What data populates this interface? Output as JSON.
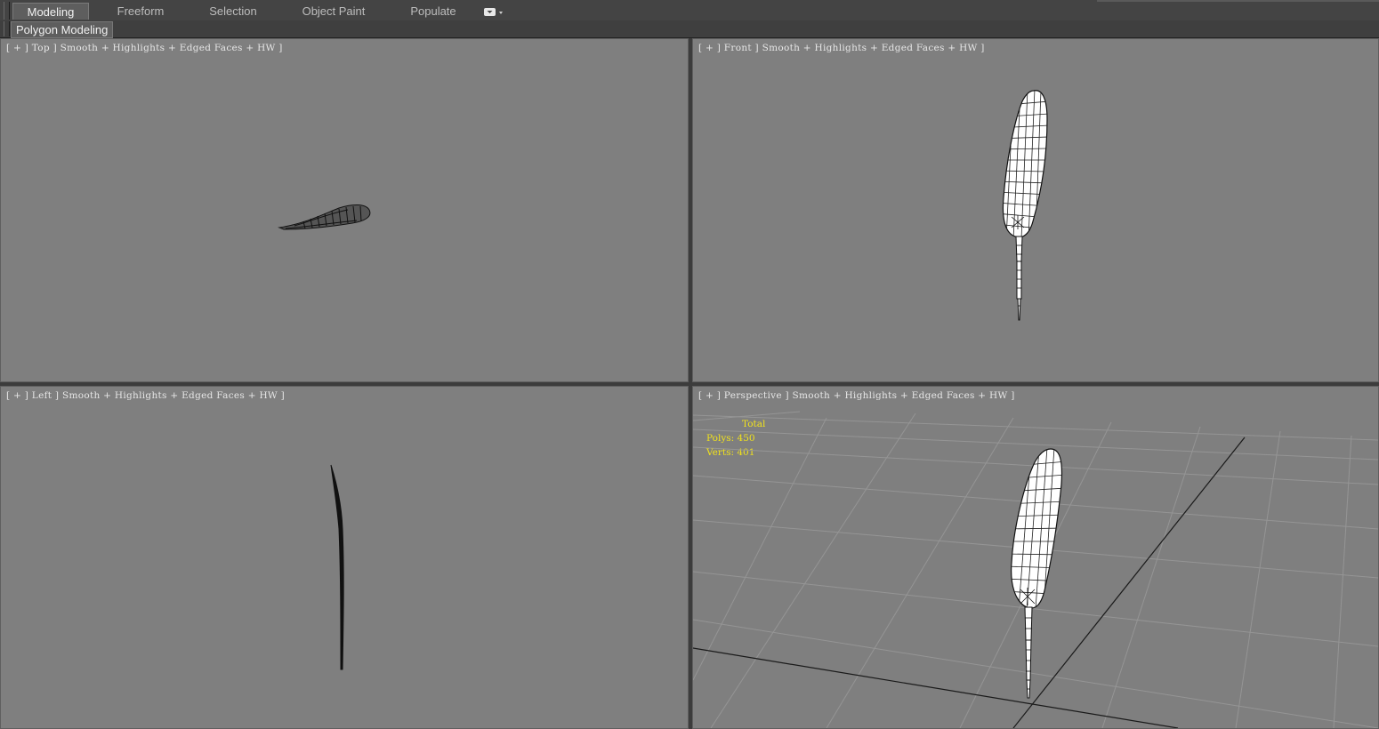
{
  "ribbon": {
    "tabs": [
      {
        "label": "Modeling",
        "active": true
      },
      {
        "label": "Freeform",
        "active": false
      },
      {
        "label": "Selection",
        "active": false
      },
      {
        "label": "Object Paint",
        "active": false
      },
      {
        "label": "Populate",
        "active": false
      }
    ],
    "dropdown_icon": "ribbon-options-dropdown-icon",
    "panel_label": "Polygon Modeling"
  },
  "viewports": {
    "top": {
      "label": "[ + ] Top ] Smooth + Highlights + Edged Faces + HW ]"
    },
    "front": {
      "label": "[ + ] Front ] Smooth + Highlights + Edged Faces + HW ]"
    },
    "left": {
      "label": "[ + ] Left ] Smooth + Highlights + Edged Faces + HW ]"
    },
    "perspective": {
      "label": "[ + ] Perspective ] Smooth + Highlights + Edged Faces + HW ]",
      "stats": {
        "title": "Total",
        "polys": "Polys: 450",
        "verts": "Verts: 401"
      }
    }
  },
  "colors": {
    "viewport_bg": "#7f7f7f",
    "stats_text": "#f1e21c",
    "active_tab_bg": "#5e5e5e"
  }
}
